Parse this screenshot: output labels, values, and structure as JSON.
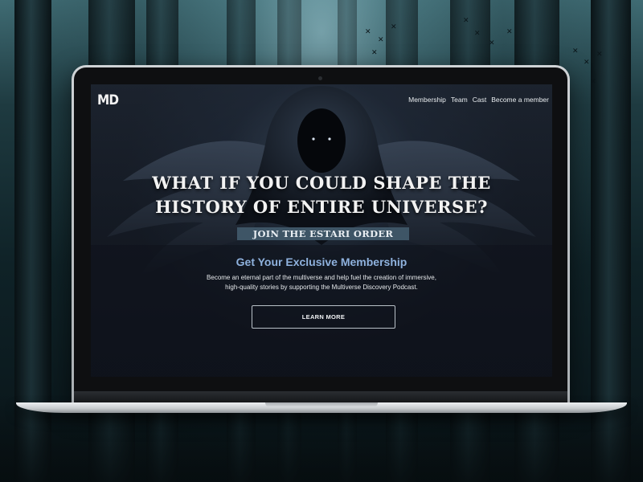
{
  "site": {
    "logo_text": "MD",
    "nav": {
      "membership": "Membership",
      "team": "Team",
      "cast": "Cast",
      "become_member": "Become a member"
    }
  },
  "hero": {
    "headline_line1": "WHAT IF YOU COULD SHAPE THE",
    "headline_line2": "HISTORY OF ENTIRE UNIVERSE?",
    "banner": "JOIN THE ESTARI ORDER"
  },
  "membership": {
    "title": "Get Your Exclusive Membership",
    "desc_line1": "Become an eternal part of the multiverse and help fuel the creation of immersive,",
    "desc_line2": "high-quality stories by supporting the Multiverse Discovery Podcast.",
    "button_label": "LEARN MORE"
  },
  "colors": {
    "accent_title": "#8fb2de",
    "banner_bg": "#3e5566",
    "screen_bg": "#161c26"
  },
  "icons": {
    "figure_art": "hooded-figure-icon"
  }
}
